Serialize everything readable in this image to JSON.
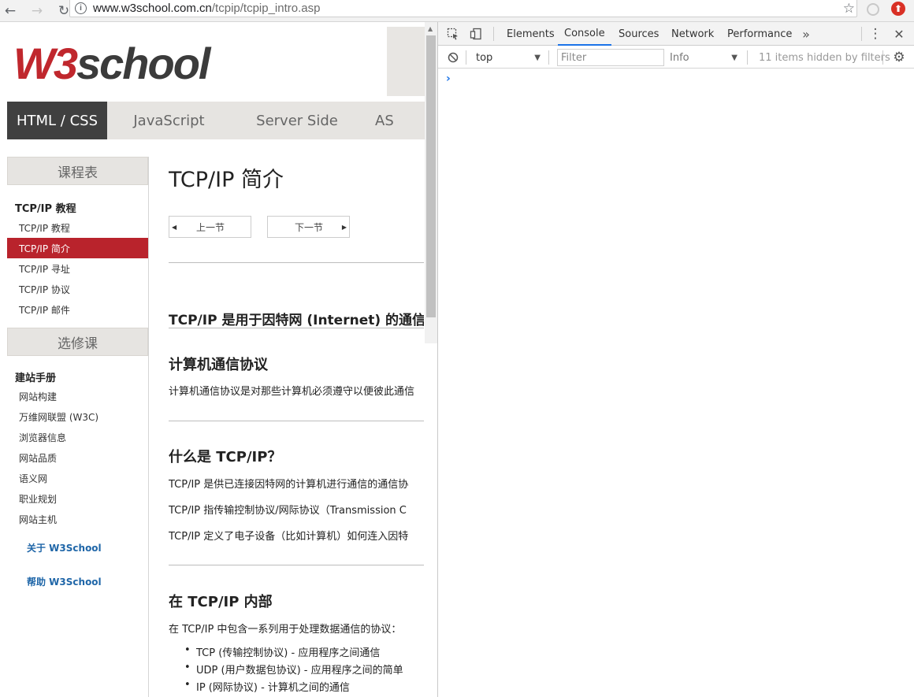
{
  "browser": {
    "back_icon": "←",
    "forward_icon": "→",
    "reload_icon": "↻",
    "url_host": "www.w3school.com.cn",
    "url_path": "/tcpip/tcpip_intro.asp",
    "star_icon": "☆",
    "info_icon": "i"
  },
  "site": {
    "logo_w3": "W3",
    "logo_school": "school",
    "nav": [
      "HTML / CSS",
      "JavaScript",
      "Server Side",
      "AS"
    ]
  },
  "sidebar": {
    "heading1": "课程表",
    "section_title": "TCP/IP 教程",
    "items": [
      "TCP/IP 教程",
      "TCP/IP 简介",
      "TCP/IP 寻址",
      "TCP/IP 协议",
      "TCP/IP 邮件"
    ],
    "heading2": "选修课",
    "section2_title": "建站手册",
    "items2": [
      "网站构建",
      "万维网联盟 (W3C)",
      "浏览器信息",
      "网站品质",
      "语义网",
      "职业规划",
      "网站主机"
    ],
    "link1": "关于 W3School",
    "link2": "帮助 W3School"
  },
  "main": {
    "title": "TCP/IP 简介",
    "prev": "上一节",
    "next": "下一节",
    "lead": "TCP/IP 是用于因特网 (Internet) 的通信",
    "h_protocol": "计算机通信协议",
    "p_protocol": "计算机通信协议是对那些计算机必须遵守以便彼此通信",
    "h_what": "什么是 TCP/IP？",
    "p_what1": "TCP/IP 是供已连接因特网的计算机进行通信的通信协",
    "p_what2": "TCP/IP 指传输控制协议/网际协议（Transmission C",
    "p_what3": "TCP/IP 定义了电子设备（比如计算机）如何连入因特",
    "h_inside": "在 TCP/IP 内部",
    "p_inside": "在 TCP/IP 中包含一系列用于处理数据通信的协议：",
    "list": [
      "TCP (传输控制协议) - 应用程序之间通信",
      "UDP (用户数据包协议) - 应用程序之间的简单",
      "IP (网际协议) - 计算机之间的通信"
    ]
  },
  "devtools": {
    "tabs": [
      "Elements",
      "Console",
      "Sources",
      "Network",
      "Performance"
    ],
    "more_icon": "»",
    "context": "top",
    "filter_placeholder": "Filter",
    "level": "Info",
    "hidden_note": "11 items hidden by filters",
    "prompt": "›",
    "close_icon": "✕",
    "menu_icon": "⋮",
    "gear_icon": "⚙"
  }
}
